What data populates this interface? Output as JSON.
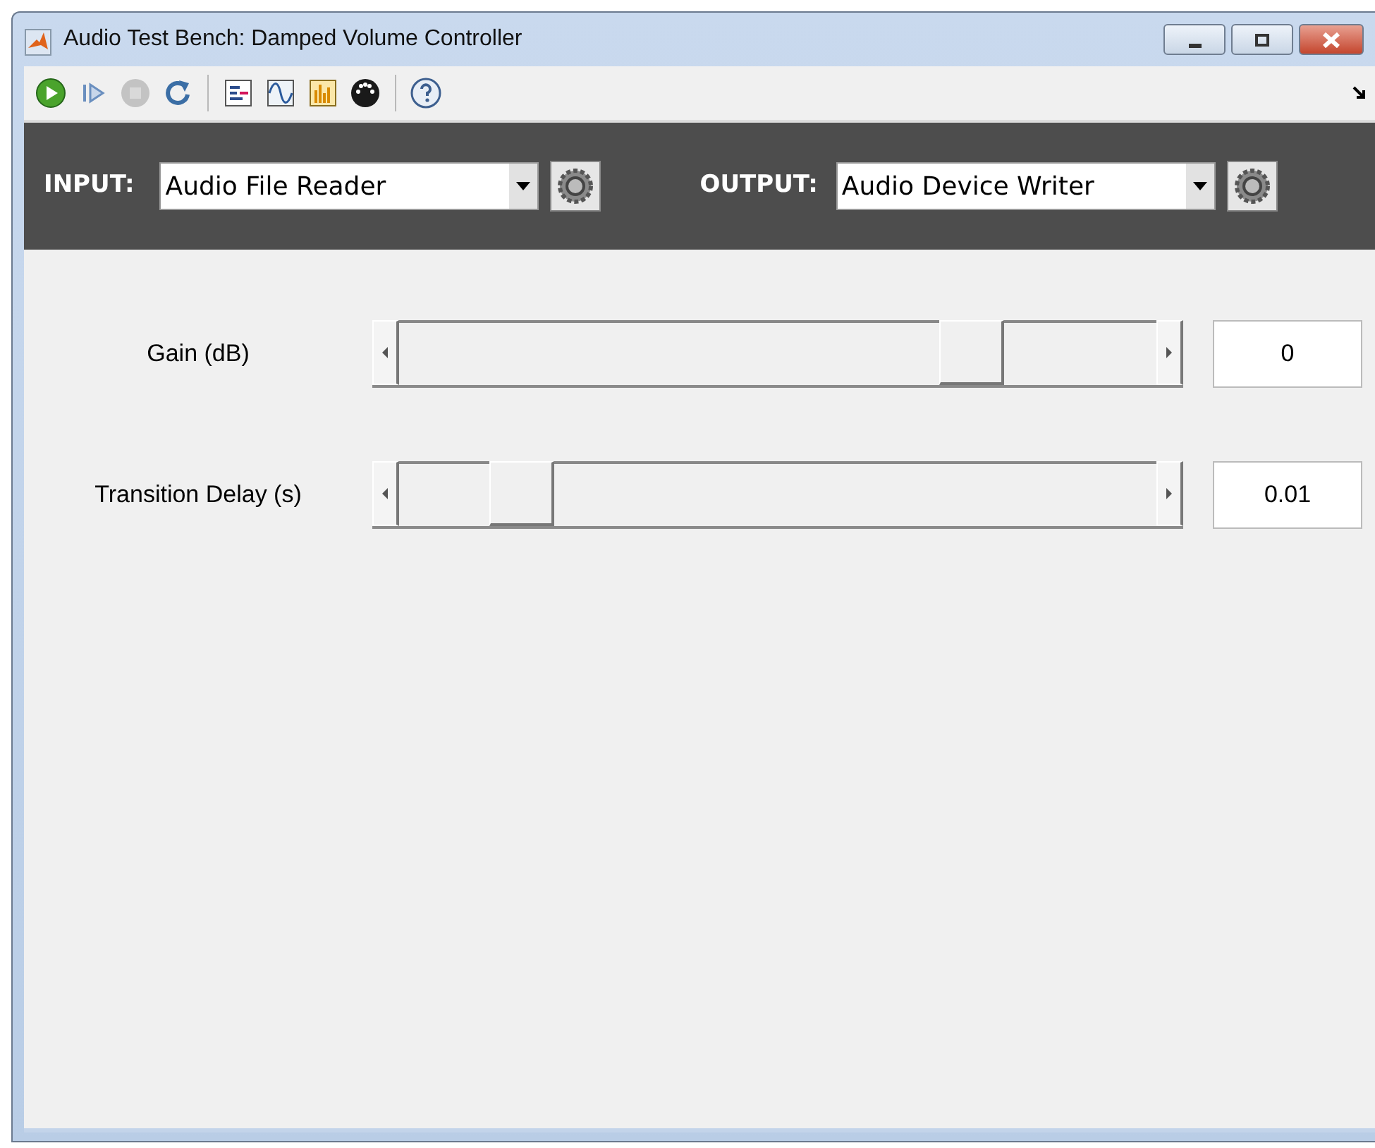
{
  "window": {
    "title": "Audio Test Bench: Damped Volume Controller"
  },
  "toolbar": [
    {
      "kind": "run",
      "disabled": false
    },
    {
      "kind": "step",
      "disabled": false
    },
    {
      "kind": "stop",
      "disabled": true
    },
    {
      "kind": "reset",
      "disabled": false
    },
    {
      "kind": "separator"
    },
    {
      "kind": "timescope",
      "disabled": false
    },
    {
      "kind": "wave",
      "disabled": false
    },
    {
      "kind": "spectrum",
      "disabled": false
    },
    {
      "kind": "midi",
      "disabled": false
    },
    {
      "kind": "separator"
    },
    {
      "kind": "help",
      "disabled": false
    }
  ],
  "io": [
    {
      "label": "INPUT:",
      "value": "Audio File Reader"
    },
    {
      "label": "OUTPUT:",
      "value": "Audio Device Writer"
    }
  ],
  "parameters": [
    {
      "label": "Gain (dB)",
      "level": 0.78,
      "value": "0"
    },
    {
      "label": "Transition Delay (s)",
      "level": 0.13,
      "value": "0.01"
    }
  ]
}
